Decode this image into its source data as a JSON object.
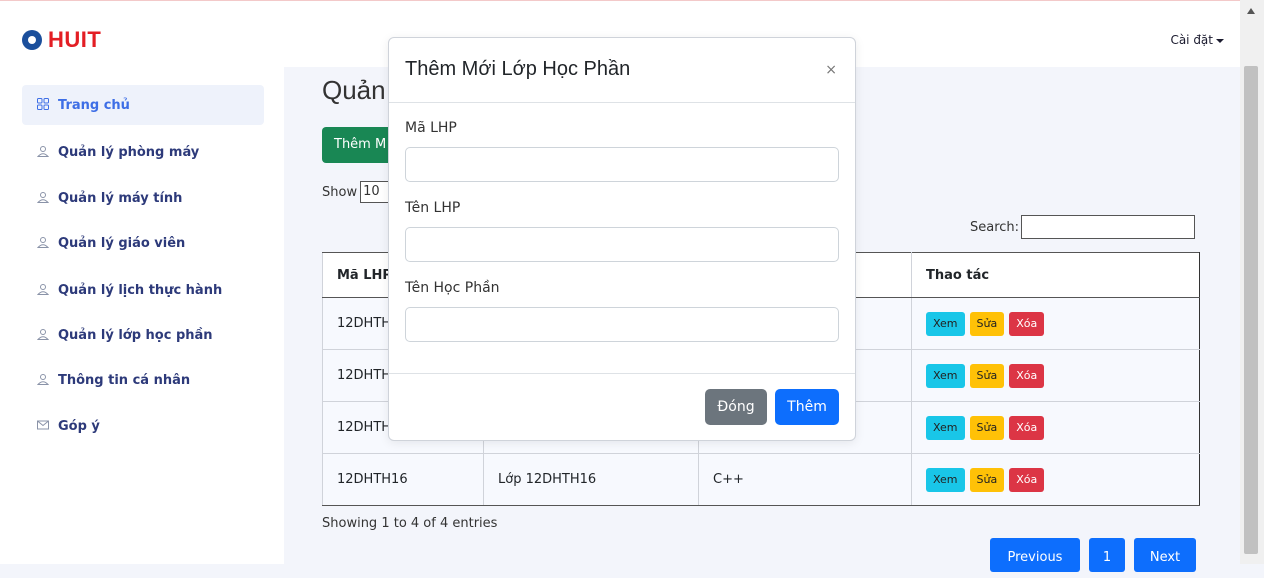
{
  "navbar": {
    "logo_text": "HUIT",
    "settings_label": "Cài đặt"
  },
  "sidebar": {
    "items": [
      {
        "label": "Trang chủ",
        "icon": "grid-icon",
        "active": true
      },
      {
        "label": "Quản lý phòng máy",
        "icon": "user-icon",
        "active": false
      },
      {
        "label": "Quản lý máy tính",
        "icon": "user-icon",
        "active": false
      },
      {
        "label": "Quản lý giáo viên",
        "icon": "user-icon",
        "active": false
      },
      {
        "label": "Quản lý lịch thực hành",
        "icon": "user-icon",
        "active": false
      },
      {
        "label": "Quản lý lớp học phần",
        "icon": "user-icon",
        "active": false
      },
      {
        "label": "Thông tin cá nhân",
        "icon": "user-icon",
        "active": false
      },
      {
        "label": "Góp ý",
        "icon": "mail-icon",
        "active": false
      }
    ]
  },
  "main": {
    "title": "Quản",
    "add_button": "Thêm M",
    "show_label": "Show",
    "show_value": "10",
    "search_label": "Search:",
    "search_value": "",
    "columns": [
      "Mã LHP",
      "",
      "",
      "Thao tác"
    ],
    "rows": [
      [
        "12DHTH",
        "",
        ""
      ],
      [
        "12DHTH",
        "",
        ""
      ],
      [
        "12DHTH",
        "",
        ""
      ],
      [
        "12DHTH16",
        "Lớp 12DHTH16",
        "C++"
      ]
    ],
    "actions": {
      "view": "Xem",
      "edit": "Sửa",
      "delete": "Xóa"
    },
    "info": "Showing 1 to 4 of 4 entries",
    "pagination": {
      "previous": "Previous",
      "page": "1",
      "next": "Next"
    }
  },
  "modal": {
    "title": "Thêm Mới Lớp Học Phần",
    "close_symbol": "×",
    "fields": [
      {
        "label": "Mã LHP",
        "value": ""
      },
      {
        "label": "Tên LHP",
        "value": ""
      },
      {
        "label": "Tên Học Phần",
        "value": ""
      }
    ],
    "close_button": "Đóng",
    "submit_button": "Thêm"
  },
  "colors": {
    "brand_red": "#e31e24",
    "primary": "#0d6efd",
    "success": "#198754",
    "info": "#19c6e8",
    "warning": "#ffc107",
    "danger": "#dc3545",
    "secondary": "#6c757d"
  }
}
